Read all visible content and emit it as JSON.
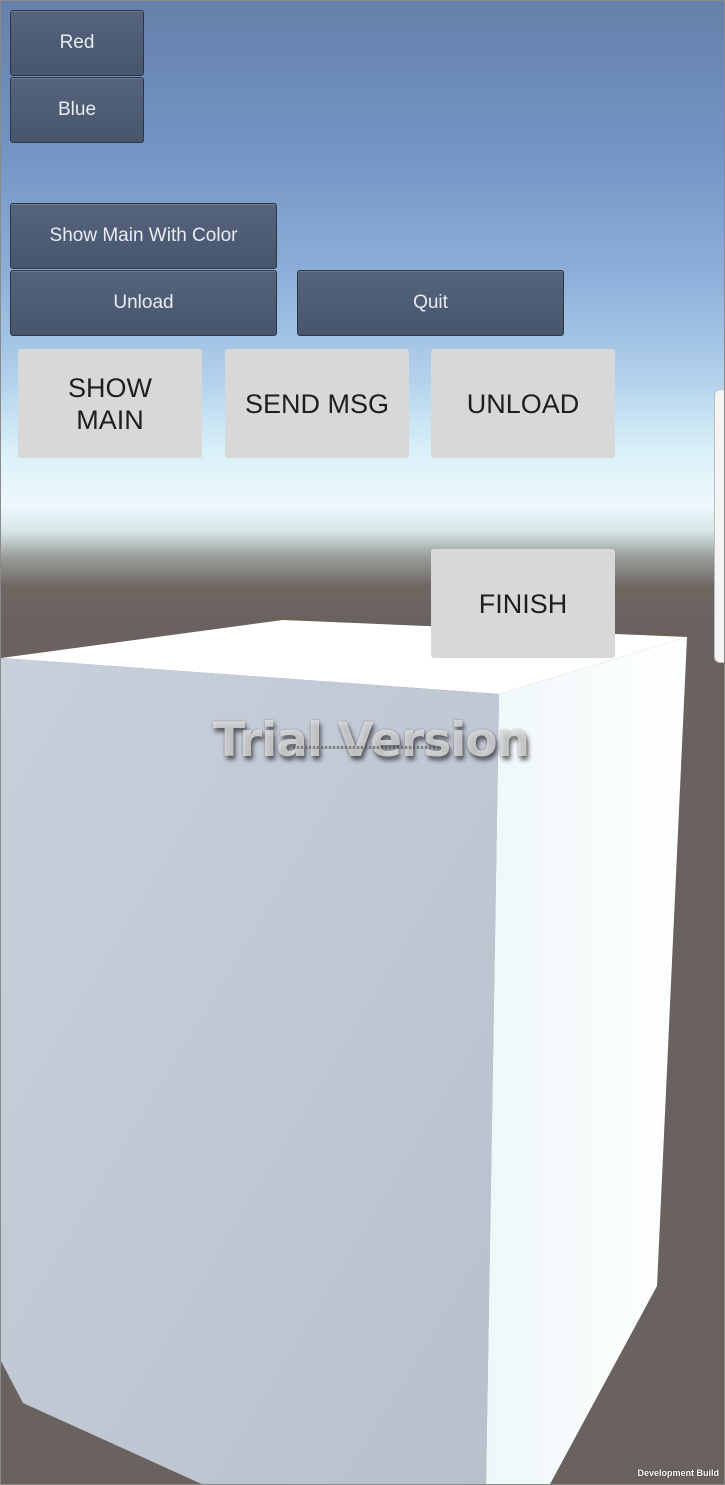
{
  "gui_buttons": {
    "red": "Red",
    "blue": "Blue",
    "show_main_with_color": "Show Main With Color",
    "unload": "Unload",
    "quit": "Quit"
  },
  "ui_buttons": {
    "show_main": "SHOW MAIN",
    "send_msg": "SEND MSG",
    "unload": "UNLOAD",
    "finish": "FINISH"
  },
  "watermark": "Trial Version",
  "dev_build": "Development Build",
  "colors": {
    "gui_button": "#4e5d75",
    "ui_button": "#d7d8d7",
    "ground": "#6a625e",
    "sky_top": "#6680aa"
  }
}
